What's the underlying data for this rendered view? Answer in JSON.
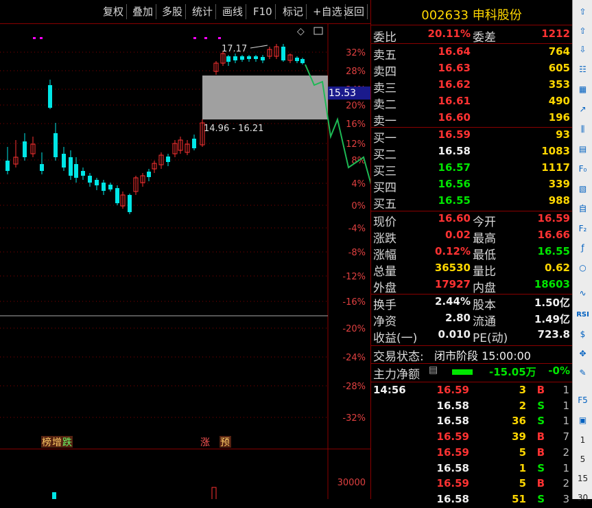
{
  "toolbar": {
    "items": [
      "复权",
      "叠加",
      "多股",
      "统计",
      "画线",
      "F10",
      "标记",
      "+自选",
      "返回"
    ]
  },
  "chart": {
    "pct_labels": [
      "32%",
      "28%",
      "24%",
      "20%",
      "16%",
      "12%",
      "8%",
      "4%",
      "0%",
      "-4%",
      "-8%",
      "-12%",
      "-16%",
      "-20%",
      "-24%",
      "-28%",
      "-32%"
    ],
    "high_label": "17.17",
    "range_label": "14.96 - 16.21",
    "cursor_price": "15.53",
    "volume_label": "30000",
    "markers": {
      "bang": "榜",
      "zeng": "增",
      "die": "跌",
      "zhang": "涨",
      "yu": "预"
    },
    "toolbar_icons": [
      "diamond-icon",
      "window-icon"
    ]
  },
  "quote": {
    "title": "002633 申科股份",
    "weibi_label": "委比",
    "weibi": "20.11%",
    "weicha_label": "委差",
    "weicha": "1212",
    "sell": [
      {
        "label": "卖五",
        "price": "16.64",
        "vol": "764"
      },
      {
        "label": "卖四",
        "price": "16.63",
        "vol": "605"
      },
      {
        "label": "卖三",
        "price": "16.62",
        "vol": "353"
      },
      {
        "label": "卖二",
        "price": "16.61",
        "vol": "490"
      },
      {
        "label": "卖一",
        "price": "16.60",
        "vol": "196"
      }
    ],
    "buy": [
      {
        "label": "买一",
        "price": "16.59",
        "vol": "93"
      },
      {
        "label": "买二",
        "price": "16.58",
        "vol": "1083"
      },
      {
        "label": "买三",
        "price": "16.57",
        "vol": "1117"
      },
      {
        "label": "买四",
        "price": "16.56",
        "vol": "339"
      },
      {
        "label": "买五",
        "price": "16.55",
        "vol": "988"
      }
    ],
    "stats": [
      {
        "l1": "现价",
        "v1": "16.60",
        "l2": "今开",
        "v2": "16.59"
      },
      {
        "l1": "涨跌",
        "v1": "0.02",
        "l2": "最高",
        "v2": "16.66"
      },
      {
        "l1": "涨幅",
        "v1": "0.12%",
        "l2": "最低",
        "v2": "16.55"
      },
      {
        "l1": "总量",
        "v1": "36530",
        "l2": "量比",
        "v2": "0.62"
      },
      {
        "l1": "外盘",
        "v1": "17927",
        "l2": "内盘",
        "v2": "18603"
      }
    ],
    "fund": [
      {
        "l1": "换手",
        "v1": "2.44%",
        "l2": "股本",
        "v2": "1.50亿"
      },
      {
        "l1": "净资",
        "v1": "2.80",
        "l2": "流通",
        "v2": "1.49亿"
      },
      {
        "l1": "收益(一)",
        "v1": "0.010",
        "l2": "PE(动)",
        "v2": "723.8"
      }
    ],
    "status_label": "交易状态:",
    "status": "闭市阶段 15:00:00",
    "mainflow_label": "主力净额",
    "mainflow": "-15.05万",
    "mainflow_pct": "-0%",
    "ticks": [
      {
        "time": "14:56",
        "price": "16.59",
        "vol": "3",
        "bs": "B",
        "cnt": "1"
      },
      {
        "time": "",
        "price": "16.58",
        "vol": "2",
        "bs": "S",
        "cnt": "1"
      },
      {
        "time": "",
        "price": "16.58",
        "vol": "36",
        "bs": "S",
        "cnt": "1"
      },
      {
        "time": "",
        "price": "16.59",
        "vol": "39",
        "bs": "B",
        "cnt": "7"
      },
      {
        "time": "",
        "price": "16.59",
        "vol": "5",
        "bs": "B",
        "cnt": "2"
      },
      {
        "time": "",
        "price": "16.58",
        "vol": "1",
        "bs": "S",
        "cnt": "1"
      },
      {
        "time": "",
        "price": "16.59",
        "vol": "5",
        "bs": "B",
        "cnt": "2"
      },
      {
        "time": "",
        "price": "16.58",
        "vol": "51",
        "bs": "S",
        "cnt": "3"
      }
    ]
  },
  "side": {
    "icons": [
      "up-arrow-icon",
      "up-outline-icon",
      "down-outline-icon",
      "list-icon",
      "grid-icon",
      "trend-icon",
      "candle-icon",
      "notes-icon",
      "f10-icon",
      "chart-icon",
      "self-icon",
      "f12-icon",
      "fx-icon",
      "circle-icon",
      "wave-icon",
      "rsi-icon",
      "dollar-icon",
      "move-icon",
      "pen-icon",
      "f5-icon",
      "page-icon"
    ],
    "labels": [
      "RSI",
      "F5",
      "1",
      "5",
      "15",
      "30"
    ]
  },
  "colors": {
    "up": "#ff3232",
    "down": "#00e6e6",
    "grid": "#8b0000",
    "accent": "#ffd700",
    "green": "#00e600"
  }
}
